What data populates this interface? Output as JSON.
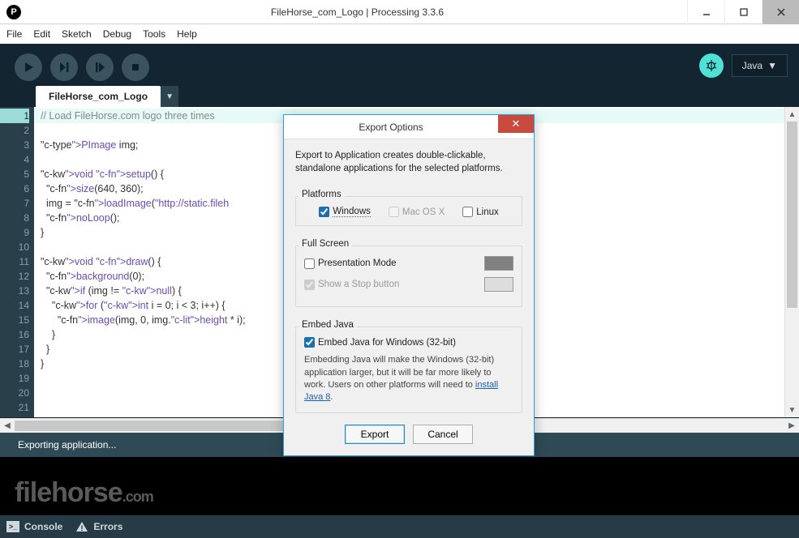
{
  "window": {
    "title": "FileHorse_com_Logo | Processing 3.3.6"
  },
  "menu": [
    "File",
    "Edit",
    "Sketch",
    "Debug",
    "Tools",
    "Help"
  ],
  "mode": {
    "label": "Java",
    "caret": "▼"
  },
  "tab": {
    "name": "FileHorse_com_Logo",
    "caret": "▼"
  },
  "code": {
    "lines": [
      "// Load FileHorse.com logo three times",
      "",
      "PImage img;",
      "",
      "void setup() {",
      "  size(640, 360);",
      "  img = loadImage(\"http://static.fileh",
      "  noLoop();",
      "}",
      "",
      "void draw() {",
      "  background(0);",
      "  if (img != null) {",
      "    for (int i = 0; i < 3; i++) {",
      "      image(img, 0, img.height * i);",
      "    }",
      "  }",
      "}",
      "",
      "",
      "",
      ""
    ],
    "highlight_line": 1
  },
  "status": {
    "text": "Exporting application..."
  },
  "bottom_tabs": {
    "console": "Console",
    "errors": "Errors"
  },
  "watermark": {
    "name": "filehorse",
    "suffix": ".com"
  },
  "dialog": {
    "title": "Export Options",
    "intro1": "Export to Application creates double-clickable,",
    "intro2": "standalone applications for the selected platforms.",
    "platforms_label": "Platforms",
    "platforms": {
      "windows": "Windows",
      "macos": "Mac OS X",
      "linux": "Linux"
    },
    "fullscreen_label": "Full Screen",
    "presentation": "Presentation Mode",
    "stopbutton": "Show a Stop button",
    "embed_label": "Embed Java",
    "embed_check": "Embed Java for Windows (32-bit)",
    "embed_note_1": "Embedding Java will make the Windows (32-bit) application larger, but it will be far more likely to work. Users on other platforms will need to ",
    "embed_link": "install Java 8",
    "embed_note_2": ".",
    "export_btn": "Export",
    "cancel_btn": "Cancel"
  }
}
